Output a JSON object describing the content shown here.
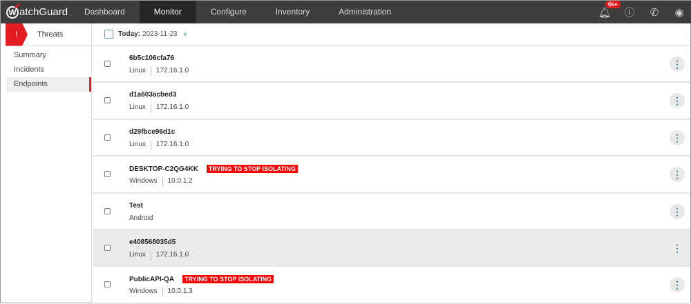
{
  "app": {
    "logo": "WatchGuard"
  },
  "nav": [
    "Dashboard",
    "Monitor",
    "Configure",
    "Inventory",
    "Administration"
  ],
  "active_nav": "Monitor",
  "notifications_badge": "6k+",
  "sidebar": {
    "title": "Threats",
    "items": [
      "Summary",
      "Incidents",
      "Endpoints"
    ],
    "active": "Endpoints"
  },
  "date": {
    "label": "Today",
    "value": "2023-11-23"
  },
  "endpoints": [
    {
      "name": "6b5c106cfa76",
      "os": "Linux",
      "ip": "172.16.1.0",
      "status": ""
    },
    {
      "name": "d1a603acbed3",
      "os": "Linux",
      "ip": "172.16.1.0",
      "status": ""
    },
    {
      "name": "d29fbce96d1c",
      "os": "Linux",
      "ip": "172.16.1.0",
      "status": ""
    },
    {
      "name": "DESKTOP-C2QG4KK",
      "os": "Windows",
      "ip": "10.0.1.2",
      "status": "TRYING TO STOP ISOLATING"
    },
    {
      "name": "Test",
      "os": "Android",
      "ip": "",
      "status": ""
    },
    {
      "name": "e408568035d5",
      "os": "Linux",
      "ip": "172.16.1.0",
      "status": ""
    },
    {
      "name": "PublicAPI-QA",
      "os": "Windows",
      "ip": "10.0.1.3",
      "status": "TRYING TO STOP ISOLATING"
    }
  ],
  "colors": {
    "accent": "#e31b23",
    "teal": "#3f8d98",
    "header": "#3d3d3d"
  }
}
